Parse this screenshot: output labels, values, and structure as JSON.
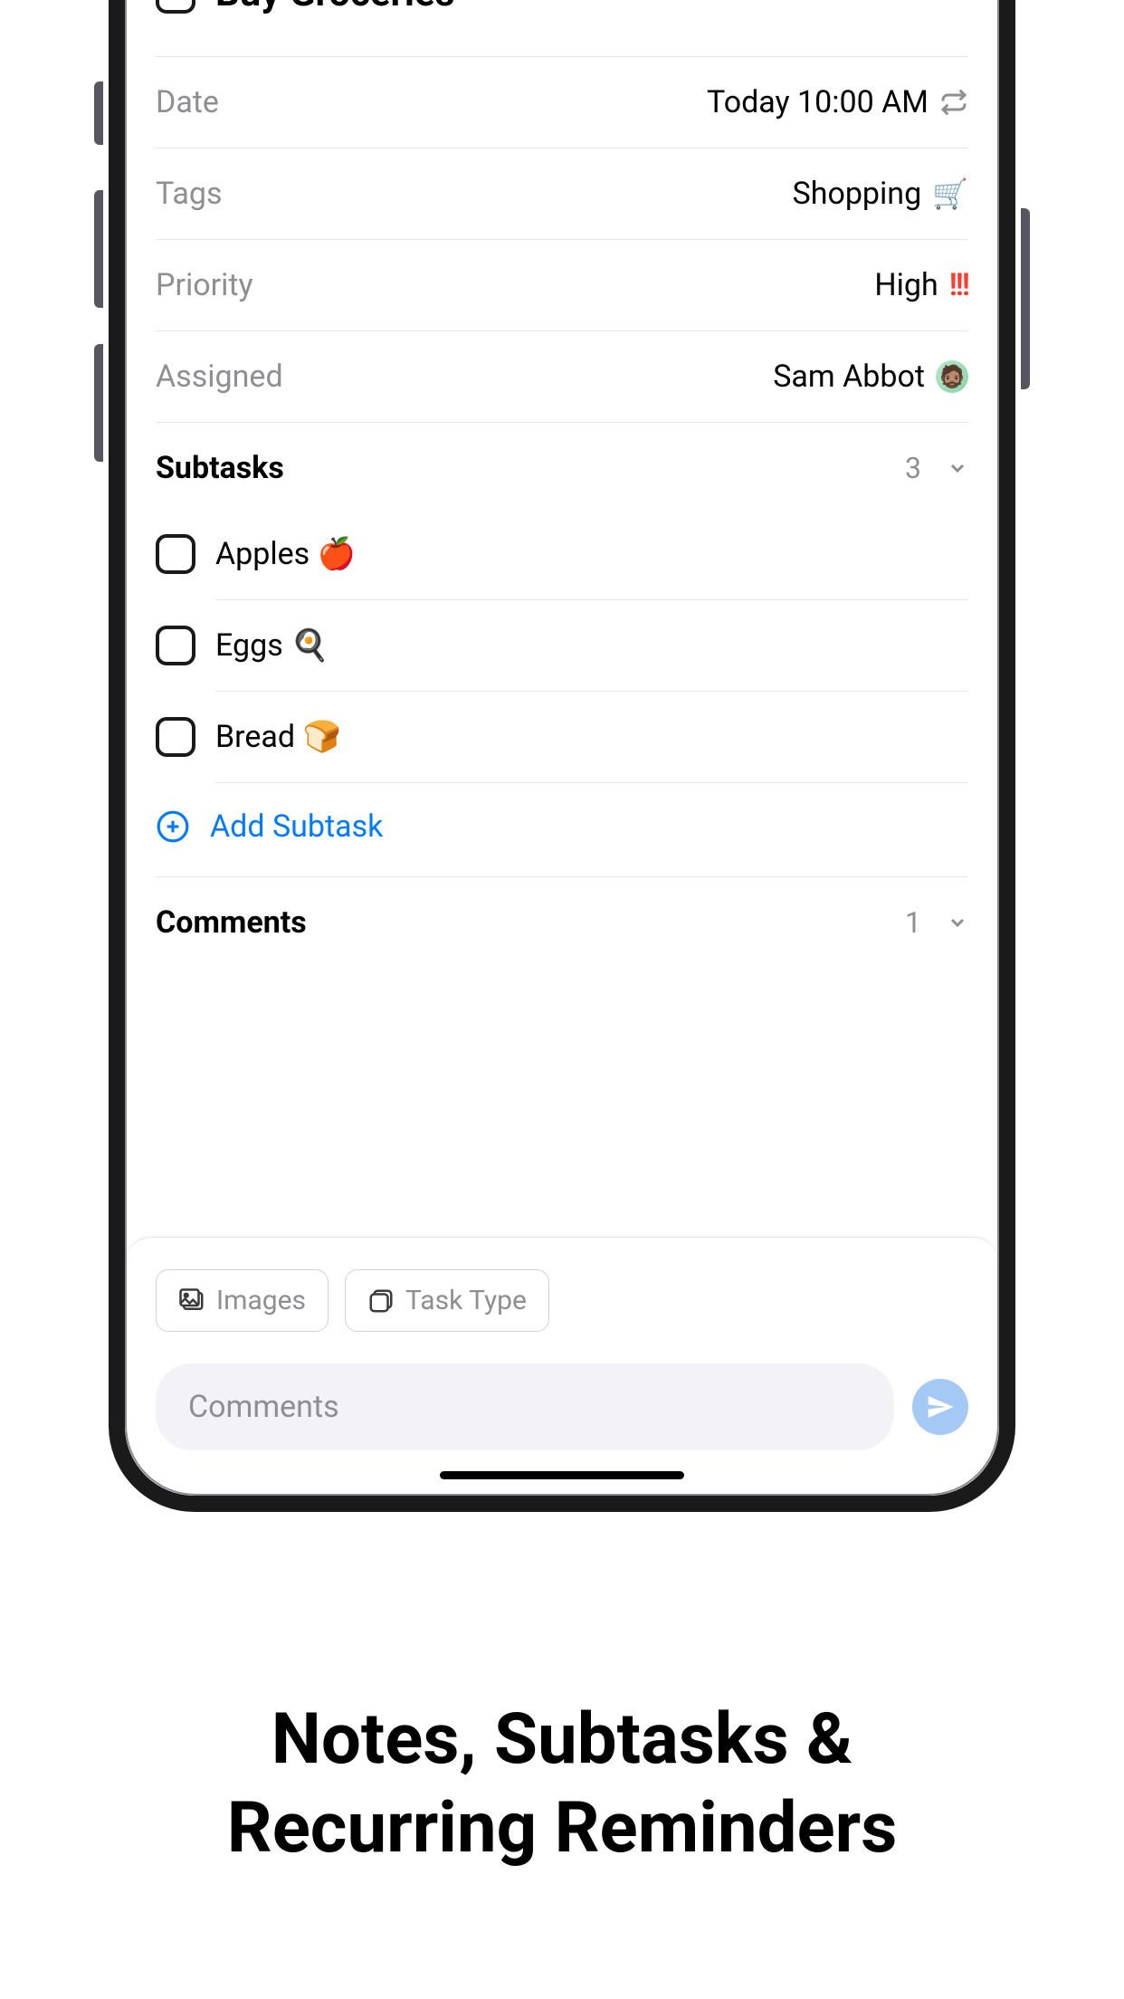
{
  "task": {
    "title": "Buy Groceries"
  },
  "details": {
    "date_label": "Date",
    "date_value": "Today 10:00 AM",
    "tags_label": "Tags",
    "tags_value": "Shopping",
    "tags_icon": "🛒",
    "priority_label": "Priority",
    "priority_value": "High",
    "priority_marks": "!!!",
    "assigned_label": "Assigned",
    "assigned_value": "Sam Abbot",
    "assigned_avatar": "🧔🏽"
  },
  "subtasks": {
    "title": "Subtasks",
    "count": "3",
    "items": [
      {
        "text": "Apples 🍎"
      },
      {
        "text": "Eggs 🍳"
      },
      {
        "text": "Bread 🍞"
      }
    ],
    "add_label": "Add Subtask"
  },
  "comments": {
    "title": "Comments",
    "count": "1",
    "chips": {
      "images": "Images",
      "task_type": "Task Type"
    },
    "placeholder": "Comments"
  },
  "promo": {
    "line1": "Notes, Subtasks &",
    "line2": "Recurring Reminders"
  }
}
